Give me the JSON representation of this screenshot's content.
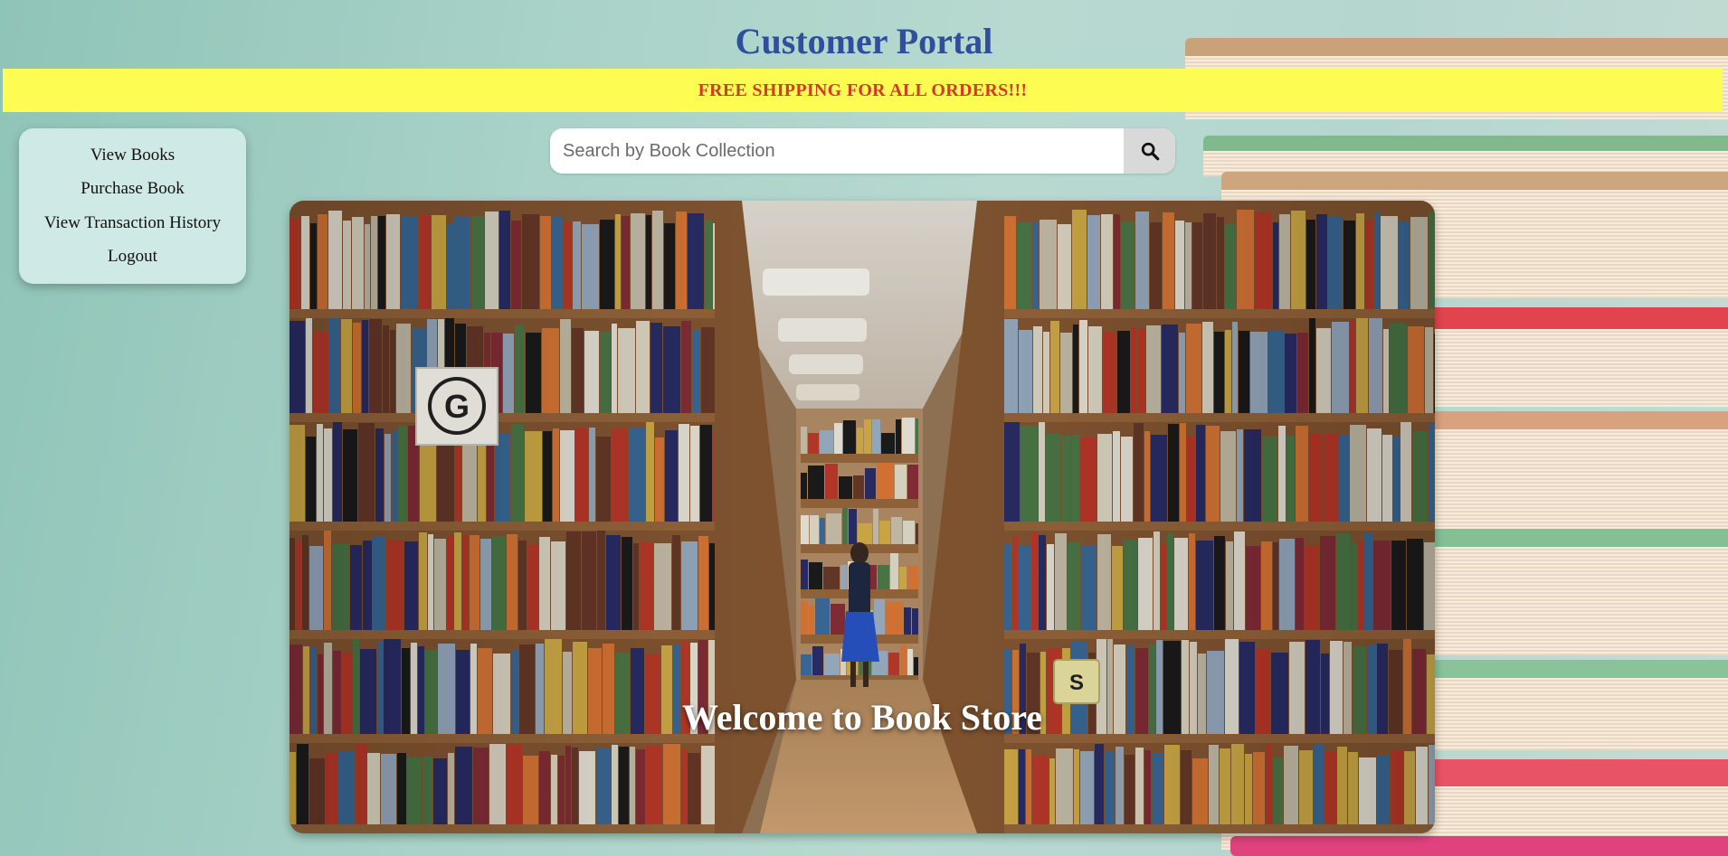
{
  "header": {
    "title": "Customer Portal"
  },
  "banner": {
    "text": "FREE SHIPPING FOR ALL ORDERS!!!"
  },
  "sidebar": {
    "items": [
      {
        "label": "View Books"
      },
      {
        "label": "Purchase Book"
      },
      {
        "label": "View Transaction History"
      },
      {
        "label": "Logout"
      }
    ]
  },
  "search": {
    "placeholder": "Search by Book Collection",
    "value": "",
    "button_icon": "search-icon"
  },
  "hero": {
    "title": "Welcome to Book Store",
    "image": "bookstore-aisle-photo",
    "sign_left": "G",
    "sign_right": "S"
  },
  "colors": {
    "title": "#2f4f9e",
    "banner_bg": "#fdfc52",
    "banner_text": "#d23a2a",
    "sidebar_bg": "#d2ebe8",
    "page_bg": "#a9d2c8"
  }
}
